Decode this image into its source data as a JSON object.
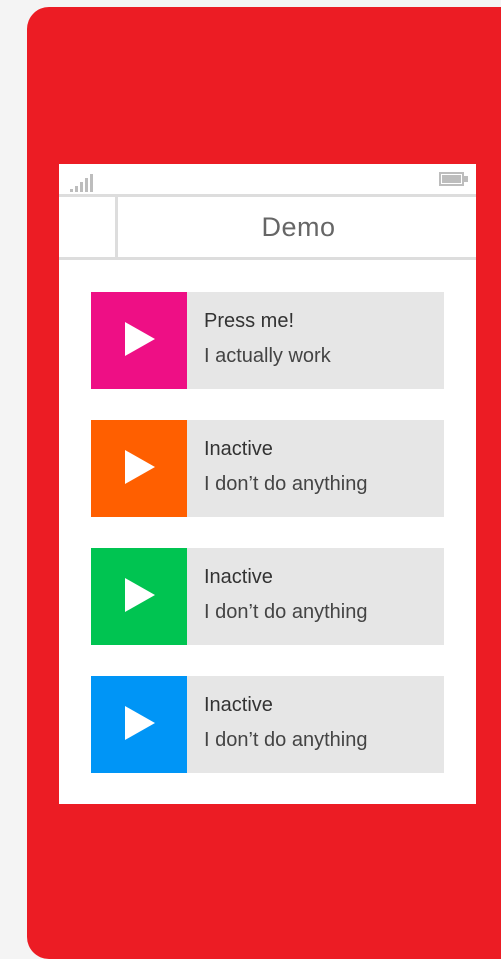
{
  "app": {
    "title": "Demo"
  },
  "status_bar": {
    "signal_icon": "signal-strength-icon",
    "battery_icon": "battery-icon"
  },
  "colors": {
    "phone_frame": "#ec1c24",
    "screen": "#ffffff",
    "item_background": "#e6e6e6"
  },
  "items": [
    {
      "title": "Press me!",
      "subtitle": "I actually work",
      "color": "#ee0f85",
      "icon": "play-icon"
    },
    {
      "title": "Inactive",
      "subtitle": "I don’t do anything",
      "color": "#ff5f00",
      "icon": "play-icon"
    },
    {
      "title": "Inactive",
      "subtitle": "I don’t do anything",
      "color": "#00c451",
      "icon": "play-icon"
    },
    {
      "title": "Inactive",
      "subtitle": "I don’t do anything",
      "color": "#0095f6",
      "icon": "play-icon"
    }
  ]
}
